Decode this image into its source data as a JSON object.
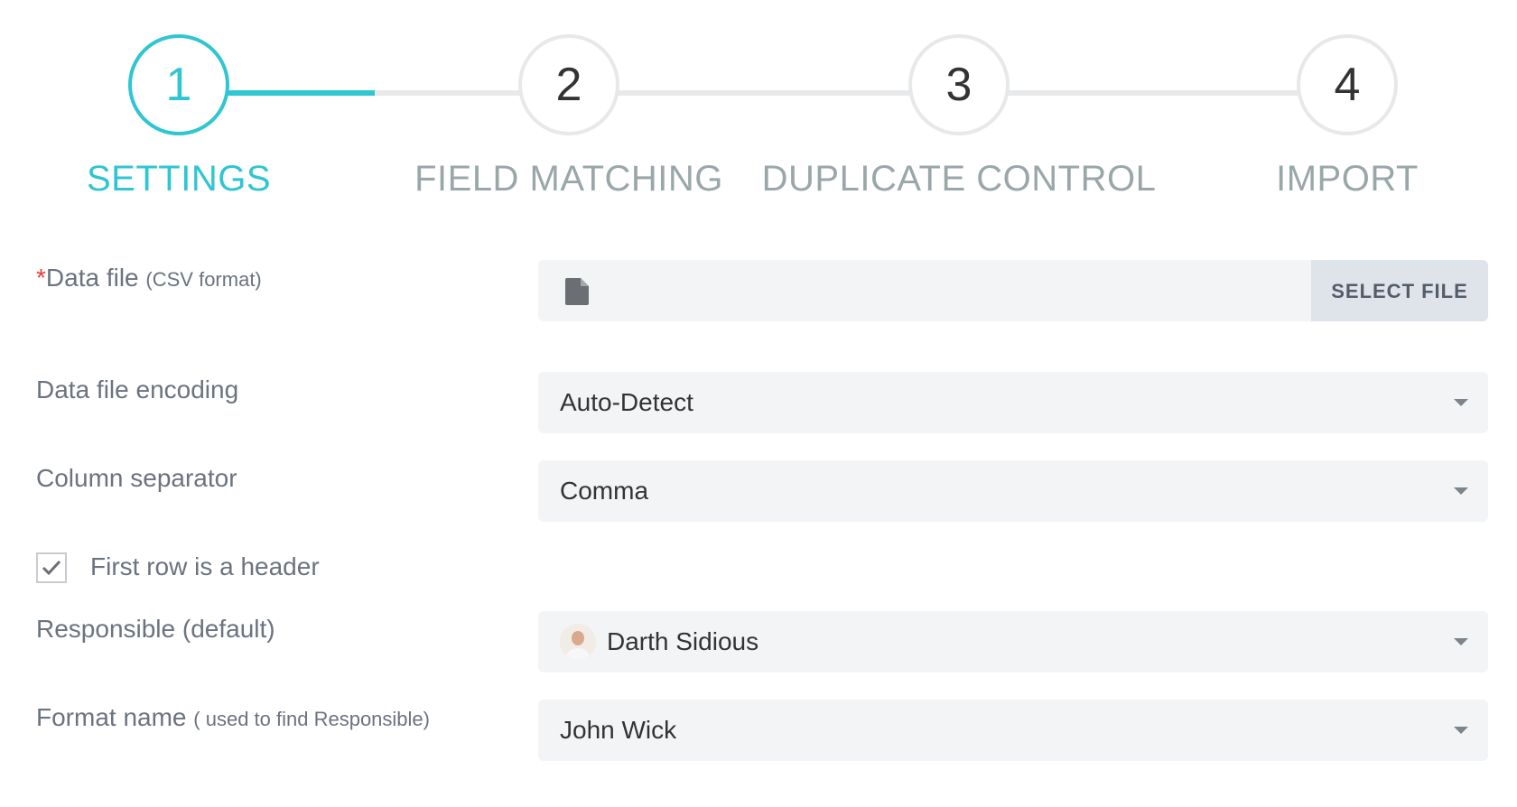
{
  "stepper": {
    "steps": [
      {
        "number": "1",
        "label": "SETTINGS",
        "state": "current"
      },
      {
        "number": "2",
        "label": "FIELD MATCHING",
        "state": "pending"
      },
      {
        "number": "3",
        "label": "DUPLICATE CONTROL",
        "state": "pending"
      },
      {
        "number": "4",
        "label": "IMPORT",
        "state": "pending"
      }
    ],
    "accent_color": "#2fc6d1"
  },
  "form": {
    "data_file": {
      "required_mark": "*",
      "label": "Data file",
      "hint": "(CSV format)",
      "icon": "file-icon",
      "value": "",
      "button_label": "SELECT FILE"
    },
    "encoding": {
      "label": "Data file encoding",
      "value": "Auto-Detect"
    },
    "separator": {
      "label": "Column separator",
      "value": "Comma"
    },
    "first_row_header": {
      "label": "First row is a header",
      "checked": true
    },
    "responsible": {
      "label": "Responsible (default)",
      "value": "Darth Sidious"
    },
    "format_name": {
      "label": "Format name",
      "hint": "( used to find Responsible)",
      "value": "John Wick"
    }
  }
}
